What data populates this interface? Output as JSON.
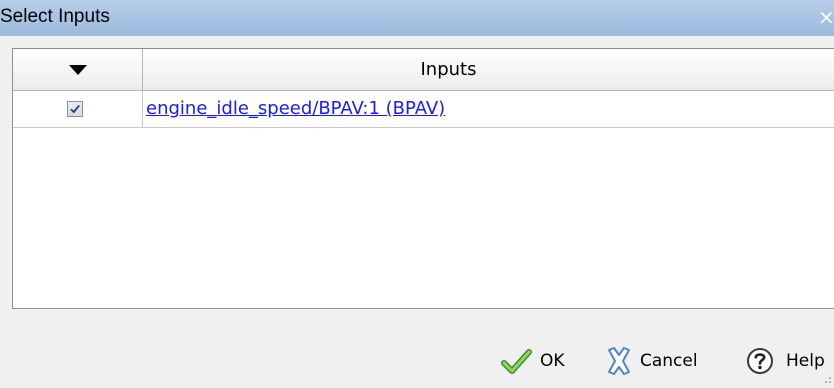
{
  "window": {
    "title": "Select Inputs",
    "close_glyph": "×"
  },
  "table": {
    "columns": [
      "",
      "Inputs"
    ],
    "header_sort_icon": "triangle-down-icon",
    "rows": [
      {
        "checked": true,
        "input": "engine_idle_speed/BPAV:1 (BPAV)"
      }
    ]
  },
  "buttons": {
    "ok": {
      "label": "OK",
      "icon": "check-icon"
    },
    "cancel": {
      "label": "Cancel",
      "icon": "cancel-x-icon"
    },
    "help": {
      "label": "Help",
      "icon": "help-question-icon"
    }
  },
  "colors": {
    "titlebar": "#a9c5e4",
    "link": "#1a1aff",
    "background": "#f0f0f0",
    "ok_icon": "#6ab84b",
    "cancel_icon": "#5a8fd0"
  }
}
